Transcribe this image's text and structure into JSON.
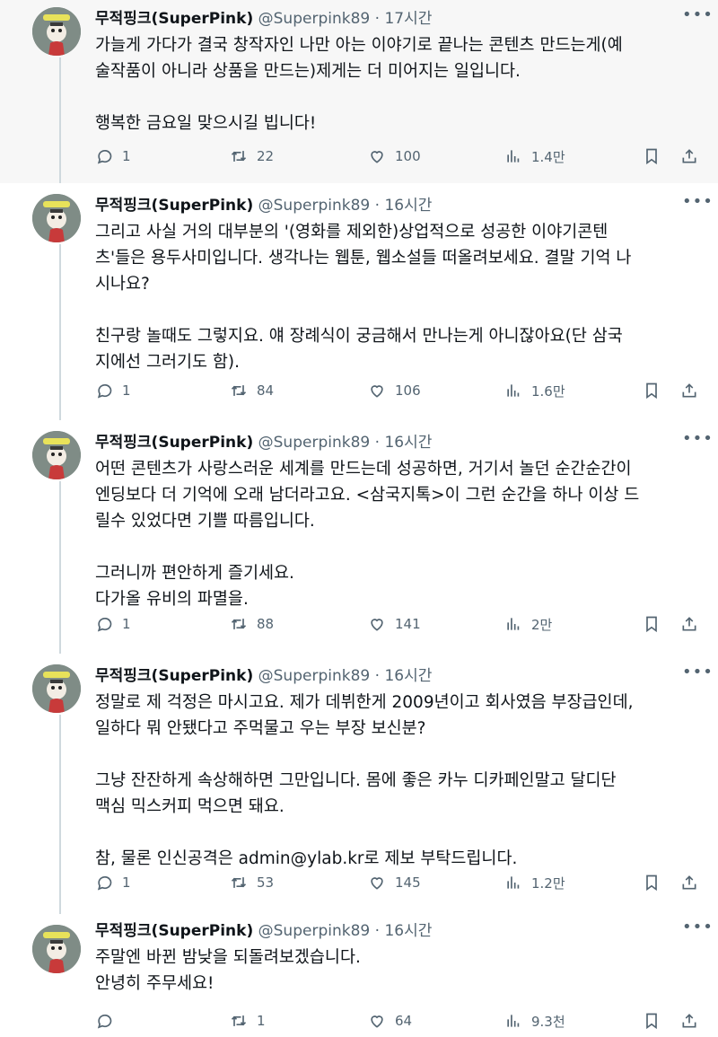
{
  "tweets": [
    {
      "name": "무적핑크(SuperPink)",
      "handle": "@Superpink89",
      "separator": "·",
      "time": "17시간",
      "paragraphs": [
        "가늘게 가다가 결국 창작자인 나만 아는 이야기로 끝나는 콘텐츠 만드는게(예\n술작품이 아니라 상품을 만드는)제게는 더 미어지는 일입니다.",
        "행복한 금요일 맞으시길 빕니다!"
      ],
      "replies": "1",
      "retweets": "22",
      "likes": "100",
      "views": "1.4만"
    },
    {
      "name": "무적핑크(SuperPink)",
      "handle": "@Superpink89",
      "separator": "·",
      "time": "16시간",
      "paragraphs": [
        "그리고 사실 거의 대부분의 '(영화를 제외한)상업적으로 성공한 이야기콘텐\n츠'들은 용두사미입니다. 생각나는 웹툰, 웹소설들 떠올려보세요. 결말 기억 나\n시나요?",
        "친구랑 놀때도 그렇지요. 얘 장례식이 궁금해서 만나는게 아니잖아요(단 삼국\n지에선 그러기도 함)."
      ],
      "replies": "1",
      "retweets": "84",
      "likes": "106",
      "views": "1.6만"
    },
    {
      "name": "무적핑크(SuperPink)",
      "handle": "@Superpink89",
      "separator": "·",
      "time": "16시간",
      "paragraphs": [
        "어떤 콘텐츠가 사랑스러운 세계를 만드는데 성공하면, 거기서 놀던 순간순간이\n엔딩보다 더 기억에 오래 남더라고요. <삼국지톡>이 그런 순간을 하나 이상 드\n릴수 있었다면 기쁠 따름입니다.",
        "그러니까 편안하게 즐기세요.\n다가올 유비의 파멸을."
      ],
      "replies": "1",
      "retweets": "88",
      "likes": "141",
      "views": "2만"
    },
    {
      "name": "무적핑크(SuperPink)",
      "handle": "@Superpink89",
      "separator": "·",
      "time": "16시간",
      "paragraphs": [
        "정말로 제 걱정은 마시고요. 제가 데뷔한게 2009년이고 회사였음 부장급인데,\n일하다 뭐 안됐다고 주먹물고 우는 부장 보신분?",
        "그냥 잔잔하게 속상해하면 그만입니다. 몸에 좋은 카누 디카페인말고 달디단\n맥심 믹스커피 먹으면 돼요.",
        "참, 물론 인신공격은 admin@ylab.kr로 제보 부탁드립니다."
      ],
      "replies": "1",
      "retweets": "53",
      "likes": "145",
      "views": "1.2만"
    },
    {
      "name": "무적핑크(SuperPink)",
      "handle": "@Superpink89",
      "separator": "·",
      "time": "16시간",
      "paragraphs": [
        "주말엔 바뀐 밤낮을 되돌려보겠습니다.\n안녕히 주무세요!"
      ],
      "replies": "",
      "retweets": "1",
      "likes": "64",
      "views": "9.3천"
    }
  ],
  "colors": {
    "text": "#0f1419",
    "muted": "#536471",
    "highlight_bg": "#f7f7f7",
    "thread_line": "#cfd9de",
    "avatar_bg": "#7f8c86"
  }
}
